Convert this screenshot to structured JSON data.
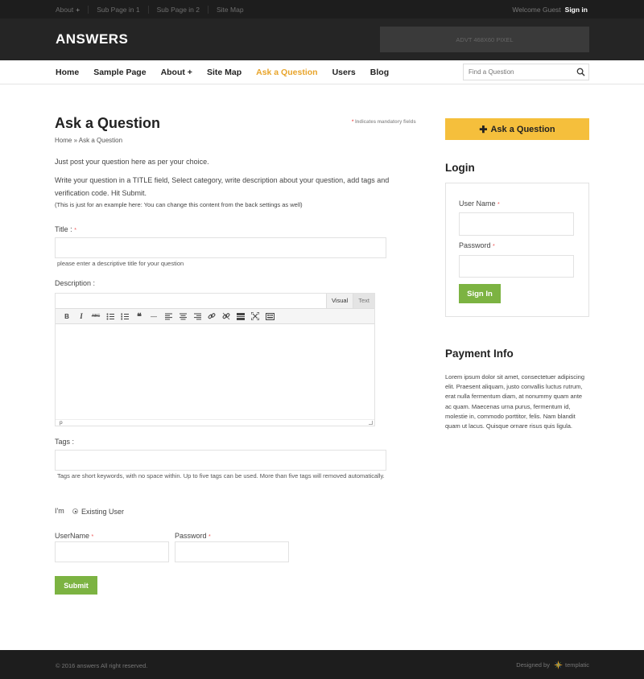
{
  "topbar": {
    "links": [
      {
        "label": "About",
        "plus": "+"
      },
      {
        "label": "Sub Page in 1"
      },
      {
        "label": "Sub Page in 2"
      },
      {
        "label": "Site Map"
      }
    ],
    "welcome": "Welcome Guest",
    "signin": "Sign in"
  },
  "header": {
    "logo": "ANSWERS",
    "advt": "ADVT 468X60 PIXEL"
  },
  "nav": {
    "items": [
      {
        "label": "Home"
      },
      {
        "label": "Sample Page"
      },
      {
        "label": "About +"
      },
      {
        "label": "Site Map"
      },
      {
        "label": "Ask a Question"
      },
      {
        "label": "Users"
      },
      {
        "label": "Blog"
      }
    ],
    "active_index": 4,
    "search_placeholder": "Find a Question"
  },
  "main": {
    "title": "Ask a Question",
    "mandatory_star": "*",
    "mandatory_text": "Indicates mandatory fields",
    "breadcrumb": "Home » Ask a Question",
    "intro1": "Just post your question here as per your choice.",
    "intro2": "Write your question in a TITLE field, Select category, write description about your question, add tags and verification code. Hit Submit.",
    "intro3": "(This is just for an example here: You can change this content from the back settings as well)",
    "title_label": "Title :",
    "title_hint": "please enter a descriptive title for your question",
    "description_label": "Description :",
    "editor": {
      "tab_visual": "Visual",
      "tab_text": "Text",
      "toolbar": [
        "B",
        "I",
        "ABC",
        "•≡",
        "1≡",
        "❝",
        "—",
        "≡",
        "≡",
        "≡",
        "🔗",
        "⛓",
        "▭",
        "⤢",
        "▦"
      ],
      "status": "p"
    },
    "tags_label": "Tags :",
    "tags_hint": "Tags are short keywords, with no space within. Up to five tags can be used. More than five tags will removed automatically.",
    "im_label": "I'm",
    "existing_user": "Existing User",
    "username_label": "UserName",
    "password_label": "Password",
    "submit": "Submit"
  },
  "sidebar": {
    "ask_button": "Ask a Question",
    "login_title": "Login",
    "username_label": "User Name",
    "password_label": "Password",
    "signin_button": "Sign In",
    "payment_title": "Payment Info",
    "payment_text": "Lorem ipsum dolor sit amet, consectetuer adipiscing elit. Praesent aliquam, justo convallis luctus rutrum, erat nulla fermentum diam, at nonummy quam ante ac quam. Maecenas urna purus, fermentum id, molestie in, commodo porttitor, felis. Nam blandit quam ut lacus. Quisque ornare risus quis ligula."
  },
  "footer": {
    "copyright": "© 2016 answers All right reserved.",
    "designed_by": "Designed by",
    "brand": "templatic"
  },
  "colors": {
    "accent": "#e8a42a",
    "ask_button": "#f5bf3c",
    "submit_green": "#7cb342",
    "dark_header": "#252525"
  }
}
